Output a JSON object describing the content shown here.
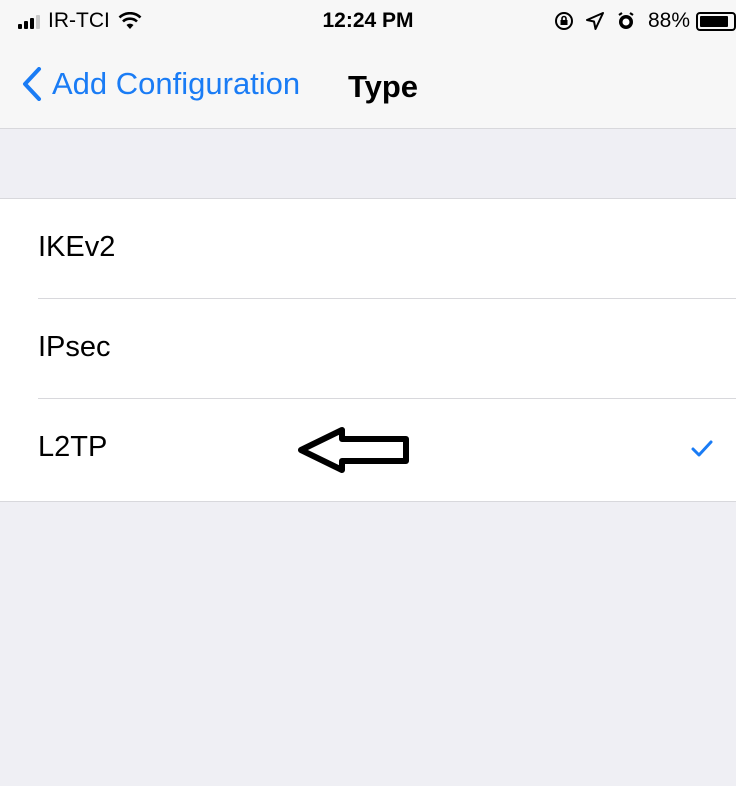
{
  "status_bar": {
    "carrier": "IR-TCI",
    "time": "12:24 PM",
    "battery_percent": "88%",
    "battery_level": 0.88,
    "icons": [
      "signal-icon",
      "wifi-icon",
      "orientation-lock-icon",
      "location-icon",
      "alarm-icon",
      "battery-icon"
    ]
  },
  "nav": {
    "back_label": "Add Configuration",
    "title": "Type",
    "accent_color": "#1a7cf5"
  },
  "types": {
    "items": [
      {
        "label": "IKEv2",
        "selected": false
      },
      {
        "label": "IPsec",
        "selected": false
      },
      {
        "label": "L2TP",
        "selected": true
      }
    ]
  },
  "annotation": {
    "icon": "left-arrow-annotation",
    "points_to": "L2TP"
  }
}
